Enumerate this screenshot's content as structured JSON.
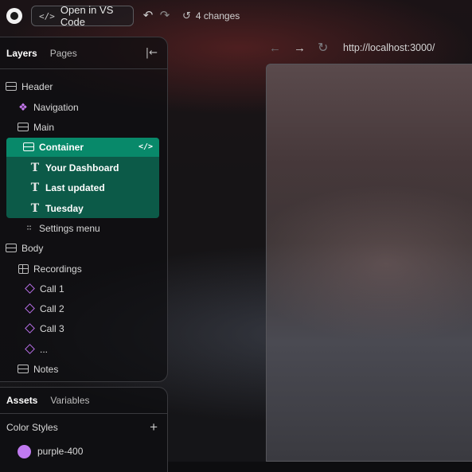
{
  "toolbar": {
    "vscode_label": "Open in VS Code",
    "vscode_icon": "code-icon",
    "changes_label": "4 changes"
  },
  "layers_panel": {
    "tabs": [
      {
        "label": "Layers",
        "active": true
      },
      {
        "label": "Pages",
        "active": false
      }
    ],
    "tree": [
      {
        "label": "Header",
        "icon": "frame-icon",
        "indent": 0
      },
      {
        "label": "Navigation",
        "icon": "component-icon",
        "indent": 1
      },
      {
        "label": "Main",
        "icon": "frame-icon",
        "indent": 1
      },
      {
        "label": "Container",
        "icon": "frame-icon",
        "indent": 2,
        "selected": true,
        "badge": "</>"
      },
      {
        "label": "Your Dashboard",
        "icon": "text-icon",
        "indent": 3
      },
      {
        "label": "Last updated",
        "icon": "text-icon",
        "indent": 3
      },
      {
        "label": "Tuesday",
        "icon": "text-icon",
        "indent": 3
      },
      {
        "label": "Settings menu",
        "icon": "dashed-frame-icon",
        "indent": 2
      },
      {
        "label": "Body",
        "icon": "frame-icon",
        "indent": 0
      },
      {
        "label": "Recordings",
        "icon": "grid-icon",
        "indent": 1
      },
      {
        "label": "Call 1",
        "icon": "instance-icon",
        "indent": 2
      },
      {
        "label": "Call 2",
        "icon": "instance-icon",
        "indent": 2
      },
      {
        "label": "Call 3",
        "icon": "instance-icon",
        "indent": 2
      },
      {
        "label": "...",
        "icon": "instance-icon",
        "indent": 2
      },
      {
        "label": "Notes",
        "icon": "frame-icon",
        "indent": 1
      }
    ]
  },
  "assets_panel": {
    "tabs": [
      {
        "label": "Assets",
        "active": true
      },
      {
        "label": "Variables",
        "active": false
      }
    ],
    "section_title": "Color Styles",
    "colors": [
      {
        "name": "purple-400",
        "hex": "#c07af0"
      }
    ]
  },
  "browser": {
    "url": "http://localhost:3000/"
  },
  "colors": {
    "selection": "#08896a",
    "selection_group": "#0c5a48",
    "component": "#c779f0"
  }
}
